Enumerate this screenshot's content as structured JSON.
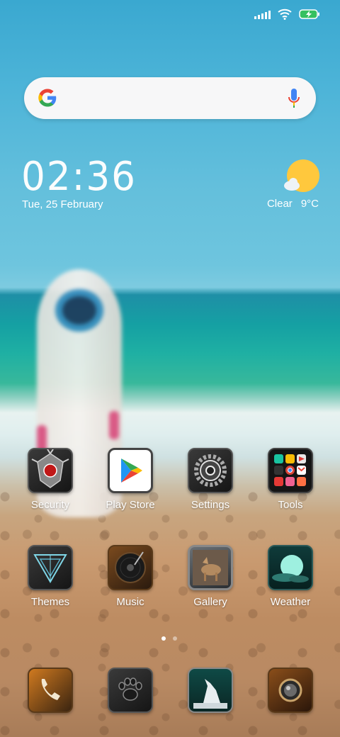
{
  "clock": {
    "time": "02:36",
    "date": "Tue, 25 February"
  },
  "weather": {
    "condition": "Clear",
    "temperature": "9°C",
    "icon": "sun-cloud-icon"
  },
  "search": {
    "logo": "google-g-icon",
    "voice": "microphone-icon"
  },
  "status_bar": {
    "icons": [
      "signal-icon",
      "wifi-icon",
      "battery-charging-icon"
    ]
  },
  "apps_row1": [
    {
      "label": "Security",
      "icon": "security-icon"
    },
    {
      "label": "Play Store",
      "icon": "play-store-icon"
    },
    {
      "label": "Settings",
      "icon": "settings-gear-icon"
    },
    {
      "label": "Tools",
      "icon": "tools-folder-icon"
    }
  ],
  "apps_row2": [
    {
      "label": "Themes",
      "icon": "themes-icon"
    },
    {
      "label": "Music",
      "icon": "music-record-icon"
    },
    {
      "label": "Gallery",
      "icon": "gallery-wolf-icon"
    },
    {
      "label": "Weather",
      "icon": "weather-moon-icon"
    }
  ],
  "dock": [
    {
      "icon": "phone-icon"
    },
    {
      "icon": "paw-icon"
    },
    {
      "icon": "howling-wolf-icon"
    },
    {
      "icon": "camera-lens-icon"
    }
  ],
  "pagination": {
    "pages": 2,
    "current": 1
  }
}
